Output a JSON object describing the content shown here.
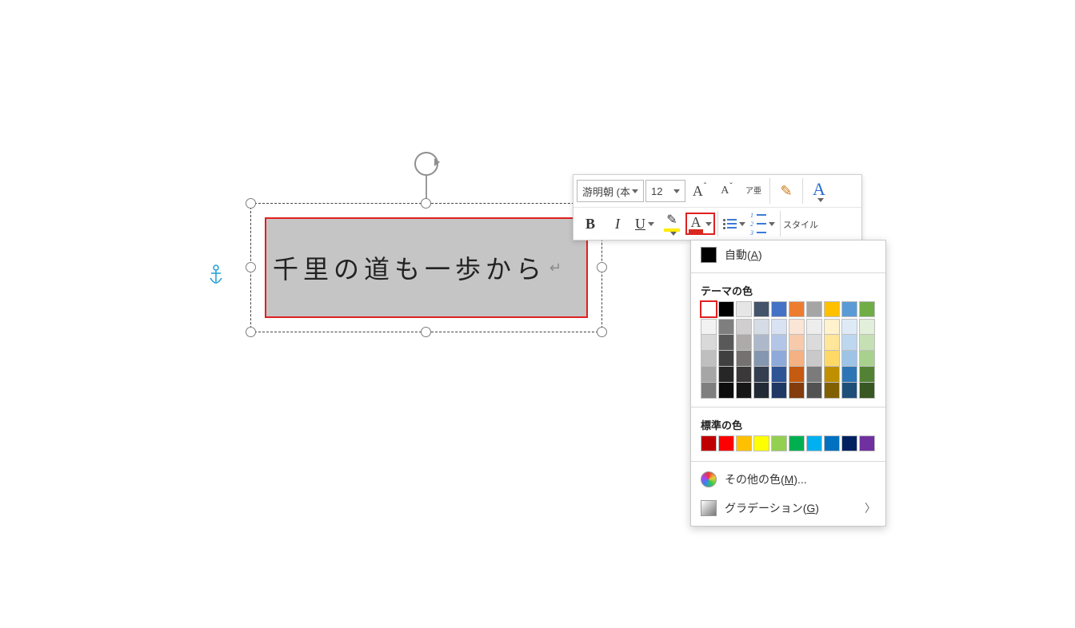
{
  "textbox": {
    "text": "千里の道も一歩から",
    "paragraph_mark": "↵"
  },
  "toolbar": {
    "font_name": "游明朝 (本",
    "font_size": "12",
    "grow_font": "A",
    "shrink_font": "A",
    "ruby_top": "ア",
    "ruby_bottom": "亜",
    "styles_label": "スタイル",
    "bold": "B",
    "italic": "I",
    "underline": "U",
    "font_color_glyph": "A",
    "highlight_glyph": "A"
  },
  "color_menu": {
    "auto_label": "自動(",
    "auto_key": "A",
    "auto_close": ")",
    "theme_header": "テーマの色",
    "theme_row": [
      "#ffffff",
      "#000000",
      "#e7e6e6",
      "#44546a",
      "#4472c4",
      "#ed7d31",
      "#a5a5a5",
      "#ffc000",
      "#5b9bd5",
      "#70ad47"
    ],
    "theme_shades": [
      [
        "#f2f2f2",
        "#d9d9d9",
        "#bfbfbf",
        "#a6a6a6",
        "#7f7f7f"
      ],
      [
        "#7f7f7f",
        "#595959",
        "#404040",
        "#262626",
        "#0d0d0d"
      ],
      [
        "#d0cece",
        "#aeaaaa",
        "#757171",
        "#3a3838",
        "#161616"
      ],
      [
        "#d6dce5",
        "#adb9ca",
        "#8497b0",
        "#333f50",
        "#222a35"
      ],
      [
        "#d9e2f3",
        "#b4c6e7",
        "#8eaadb",
        "#2f5496",
        "#1f3864"
      ],
      [
        "#fbe5d6",
        "#f7caac",
        "#f4b183",
        "#c55a11",
        "#843c0c"
      ],
      [
        "#ededed",
        "#dbdbdb",
        "#c9c9c9",
        "#7b7b7b",
        "#525252"
      ],
      [
        "#fff2cc",
        "#ffe699",
        "#ffd966",
        "#bf8f00",
        "#806000"
      ],
      [
        "#deebf7",
        "#bdd7ee",
        "#9dc3e6",
        "#2e75b6",
        "#1f4e79"
      ],
      [
        "#e2efda",
        "#c5e0b4",
        "#a9d18e",
        "#548235",
        "#385723"
      ]
    ],
    "standard_header": "標準の色",
    "standard_row": [
      "#c00000",
      "#ff0000",
      "#ffc000",
      "#ffff00",
      "#92d050",
      "#00b050",
      "#00b0f0",
      "#0070c0",
      "#002060",
      "#7030a0"
    ],
    "more_colors_label": "その他の色(",
    "more_colors_key": "M",
    "more_colors_suffix": ")...",
    "gradient_label": "グラデーション(",
    "gradient_key": "G",
    "gradient_close": ")"
  }
}
